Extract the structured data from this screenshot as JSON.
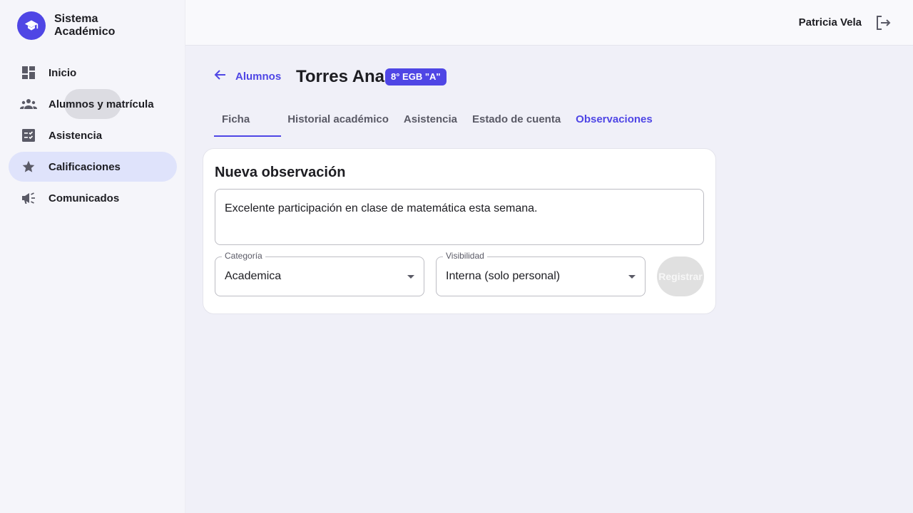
{
  "brand": {
    "title_line1": "Sistema",
    "title_line2": "Académico"
  },
  "sidebar": {
    "items": [
      {
        "label": "Inicio"
      },
      {
        "label": "Alumnos y matrícula"
      },
      {
        "label": "Asistencia"
      },
      {
        "label": "Calificaciones"
      },
      {
        "label": "Comunicados"
      }
    ]
  },
  "topbar": {
    "user_name": "Patricia Vela"
  },
  "header": {
    "back_label": "Alumnos",
    "student_name": "Torres Ana",
    "grade_badge": "8° EGB \"A\""
  },
  "tabs": [
    {
      "label": "Ficha"
    },
    {
      "label": "Historial académico"
    },
    {
      "label": "Asistencia"
    },
    {
      "label": "Estado de cuenta"
    },
    {
      "label": "Observaciones"
    }
  ],
  "form": {
    "title": "Nueva observación",
    "observation_text": "Excelente participación en clase de matemática esta semana.",
    "category_label": "Categoría",
    "category_value": "Academica",
    "visibility_label": "Visibilidad",
    "visibility_value": "Interna (solo personal)",
    "submit_label": "Registrar"
  },
  "colors": {
    "accent": "#4f46e5",
    "active_nav_bg": "#dfe3fb",
    "disabled_button": "#e0e0e0"
  }
}
